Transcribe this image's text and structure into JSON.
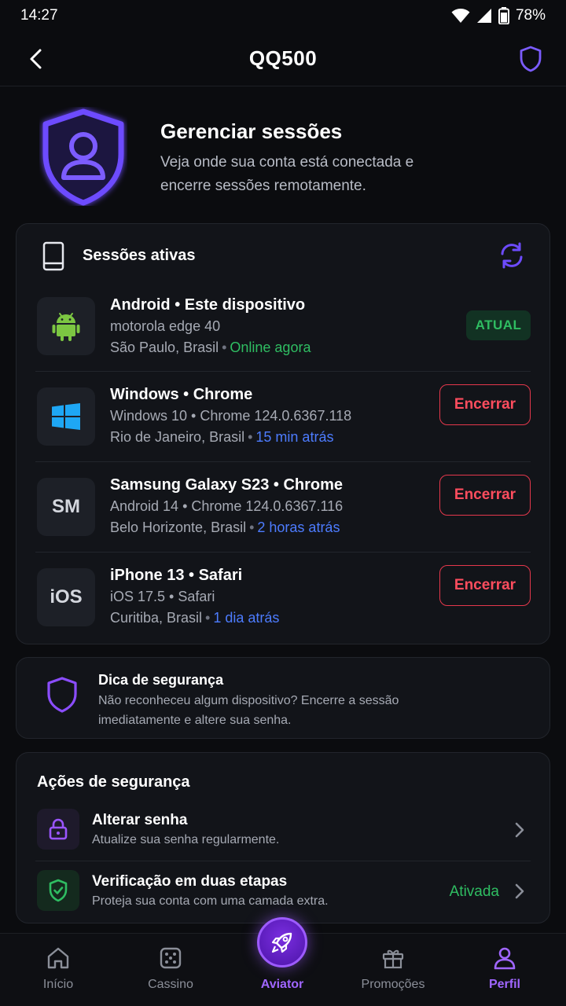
{
  "status_bar": {
    "time": "14:27",
    "battery": "78%"
  },
  "app_bar": {
    "title": "QQ500"
  },
  "hero": {
    "title": "Gerenciar sessões",
    "description": "Veja onde sua conta está conectada e encerre sessões remotamente."
  },
  "sessions": {
    "header": "Sessões ativas",
    "items": [
      {
        "icon": "android-icon",
        "icon_text": "",
        "title": "Android • Este dispositivo",
        "subtitle": "motorola edge 40",
        "location": "São Paulo, Brasil",
        "status": "Online agora",
        "status_color": "#2fbd62",
        "badge": "ATUAL",
        "action": ""
      },
      {
        "icon": "windows-icon",
        "icon_text": "",
        "title": "Windows • Chrome",
        "subtitle": "Windows 10 • Chrome 124.0.6367.118",
        "location": "Rio de Janeiro, Brasil",
        "status": "15 min atrás",
        "status_color": "#4d7cff",
        "badge": "",
        "action": "Encerrar"
      },
      {
        "icon": "samsung-text-icon",
        "icon_text": "SM",
        "title": "Samsung Galaxy S23 • Chrome",
        "subtitle": "Android 14 • Chrome 124.0.6367.116",
        "location": "Belo Horizonte, Brasil",
        "status": "2 horas atrás",
        "status_color": "#4d7cff",
        "badge": "",
        "action": "Encerrar"
      },
      {
        "icon": "ios-text-icon",
        "icon_text": "iOS",
        "title": "iPhone 13 • Safari",
        "subtitle": "iOS 17.5 • Safari",
        "location": "Curitiba, Brasil",
        "status": "1 dia atrás",
        "status_color": "#4d7cff",
        "badge": "",
        "action": "Encerrar"
      }
    ]
  },
  "tip": {
    "title": "Dica de segurança",
    "description": "Não reconheceu algum dispositivo? Encerre a sessão imediatamente e altere sua senha."
  },
  "actions": {
    "header": "Ações de segurança",
    "items": [
      {
        "title": "Alterar senha",
        "description": "Atualize sua senha regularmente.",
        "status": ""
      },
      {
        "title": "Verificação em duas etapas",
        "description": "Proteja sua conta com uma camada extra.",
        "status": "Ativada"
      }
    ]
  },
  "nav": {
    "items": [
      {
        "label": "Início",
        "active": false
      },
      {
        "label": "Cassino",
        "active": false
      },
      {
        "label": "Aviator",
        "active": false
      },
      {
        "label": "Promoções",
        "active": false
      },
      {
        "label": "Perfil",
        "active": true
      }
    ]
  },
  "colors": {
    "accent": "#7b4dff",
    "purple_nav": "#a066ff",
    "danger": "#ff4d5e",
    "success": "#2fbd62",
    "link": "#4d7cff",
    "background": "#0b0c0f"
  }
}
